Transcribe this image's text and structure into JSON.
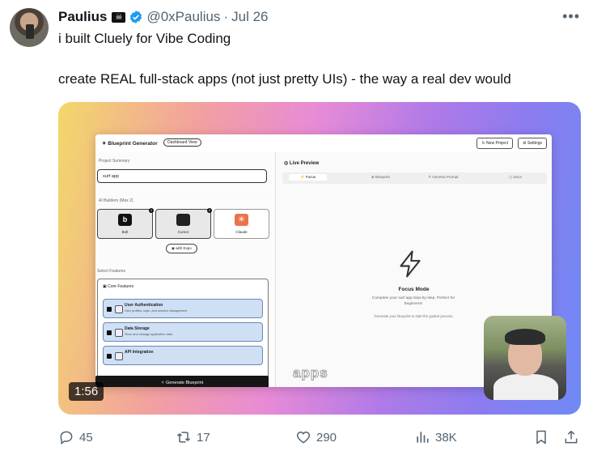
{
  "tweet": {
    "author_name": "Paulius",
    "author_handle": "@0xPaulius",
    "dot": "·",
    "date": "Jul 26",
    "line1": "i built Cluely for Vibe Coding",
    "line2": "create REAL full-stack apps (not just pretty UIs) - the way a real dev would"
  },
  "video": {
    "duration": "1:56",
    "caption": "apps",
    "app": {
      "title": "Blueprint Generator",
      "dashboard_view": "Dashboard View",
      "new_project": "New Project",
      "settings": "Settings",
      "project_summary_label": "Project Summary",
      "project_summary_value": "surf app",
      "ai_builders_label": "AI Builders (Max 2)",
      "builders": [
        {
          "name": "Bolt",
          "badge": "1"
        },
        {
          "name": "Cursor",
          "badge": "2"
        },
        {
          "name": "Claude",
          "badge": ""
        }
      ],
      "with_expo": "with Expo",
      "select_features_label": "Select Features",
      "core_features": "Core Features",
      "features": [
        {
          "title": "User Authentication",
          "desc": "User profiles, login, and session management"
        },
        {
          "title": "Data Storage",
          "desc": "Store and manage application data"
        },
        {
          "title": "API Integration",
          "desc": ""
        }
      ],
      "generate_button": "Generate Blueprint",
      "live_preview": "Live Preview",
      "tabs": [
        "Focus",
        "Blueprint",
        "Genesis Prompt",
        "Docs"
      ],
      "focus_title": "Focus Mode",
      "focus_desc": "Complete your surf app step-by-step. Perfect for beginners!",
      "focus_sub": "Generate your blueprint to start the guided process."
    }
  },
  "actions": {
    "replies": "45",
    "reposts": "17",
    "likes": "290",
    "views": "38K"
  },
  "colors": {
    "verified": "#1d9bf0",
    "muted": "#536471"
  }
}
